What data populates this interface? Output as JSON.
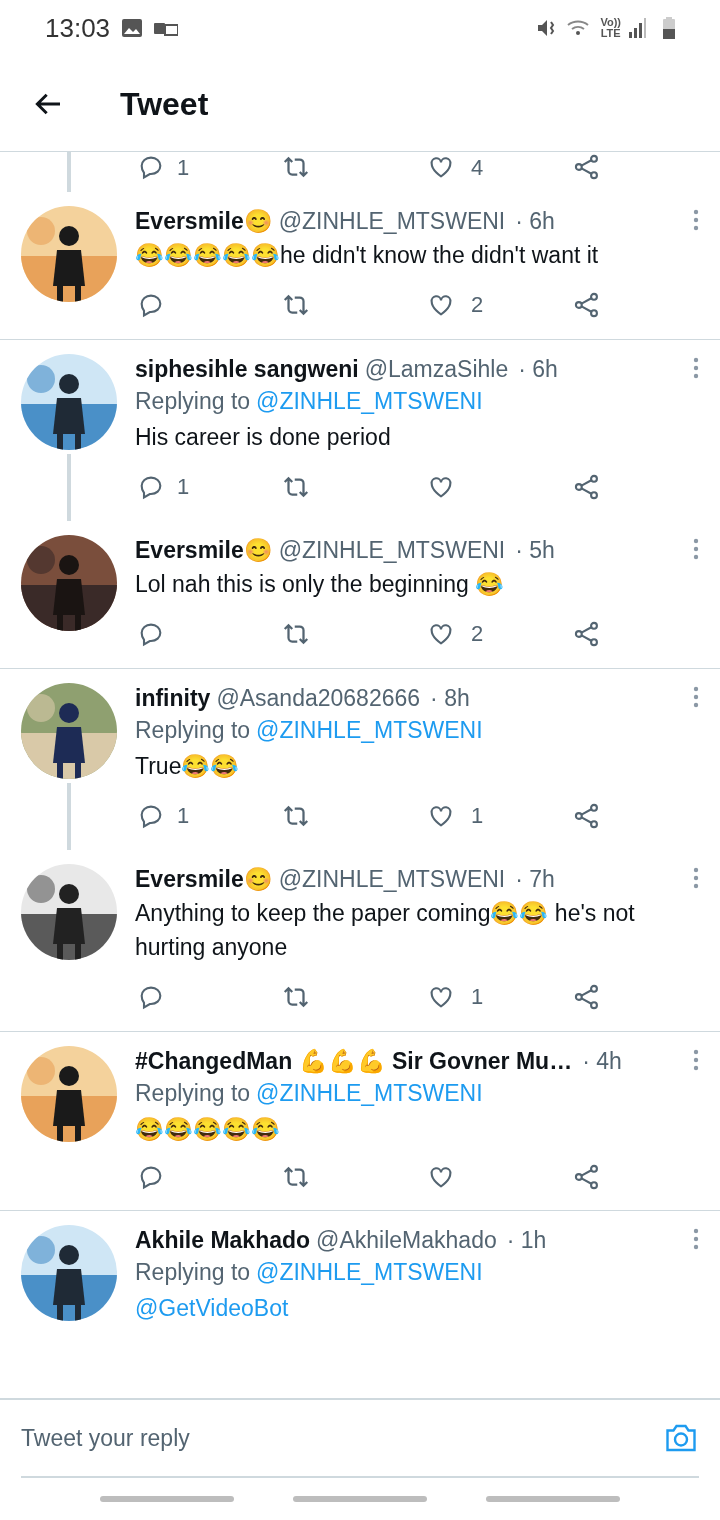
{
  "status_bar": {
    "time": "13:03",
    "network_label_top": "Vo))",
    "network_label_bottom": "LTE"
  },
  "header": {
    "title": "Tweet"
  },
  "top_actions": {
    "replies": "1",
    "likes": "4",
    "threaded": true
  },
  "conversations": [
    {
      "tweets": [
        {
          "name": "Eversmile😊",
          "handle": "@ZINHLE_MTSWENI",
          "time": "· 6h",
          "text": "😂😂😂😂😂he didn't know the didn't want it",
          "likes": "2",
          "actions_shown": true,
          "threaded": false
        }
      ]
    },
    {
      "tweets": [
        {
          "name": "siphesihle sangweni",
          "handle": "@LamzaSihle",
          "time": "· 6h",
          "replying_label": "Replying to",
          "replying_to": "@ZINHLE_MTSWENI",
          "text": "His career is done period",
          "replies": "1",
          "actions_shown": true,
          "threaded": true
        },
        {
          "name": "Eversmile😊",
          "handle": "@ZINHLE_MTSWENI",
          "time": "· 5h",
          "text": "Lol nah this is only the beginning 😂",
          "likes": "2",
          "actions_shown": true,
          "threaded": false
        }
      ]
    },
    {
      "tweets": [
        {
          "name": "infinity",
          "handle": "@Asanda20682666",
          "time": "· 8h",
          "replying_label": "Replying to",
          "replying_to": "@ZINHLE_MTSWENI",
          "text": "True😂😂",
          "replies": "1",
          "likes": "1",
          "actions_shown": true,
          "threaded": true
        },
        {
          "name": "Eversmile😊",
          "handle": "@ZINHLE_MTSWENI",
          "time": "· 7h",
          "text": "Anything to keep the paper coming😂😂 he's not hurting anyone",
          "likes": "1",
          "actions_shown": true,
          "threaded": false
        }
      ]
    },
    {
      "tweets": [
        {
          "name": "#ChangedMan 💪💪💪 Sir Govner Mu…",
          "time": "· 4h",
          "replying_label": "Replying to",
          "replying_to": "@ZINHLE_MTSWENI",
          "text": "😂😂😂😂😂",
          "actions_shown": true,
          "threaded": false
        }
      ]
    },
    {
      "tweets": [
        {
          "name": "Akhile Makhado",
          "handle": "@AkhileMakhado",
          "time": "· 1h",
          "replying_label": "Replying to",
          "replying_to": "@ZINHLE_MTSWENI",
          "text_link": "@GetVideoBot",
          "actions_shown": false,
          "threaded": false
        }
      ]
    }
  ],
  "reply_box": {
    "placeholder": "Tweet your reply"
  }
}
